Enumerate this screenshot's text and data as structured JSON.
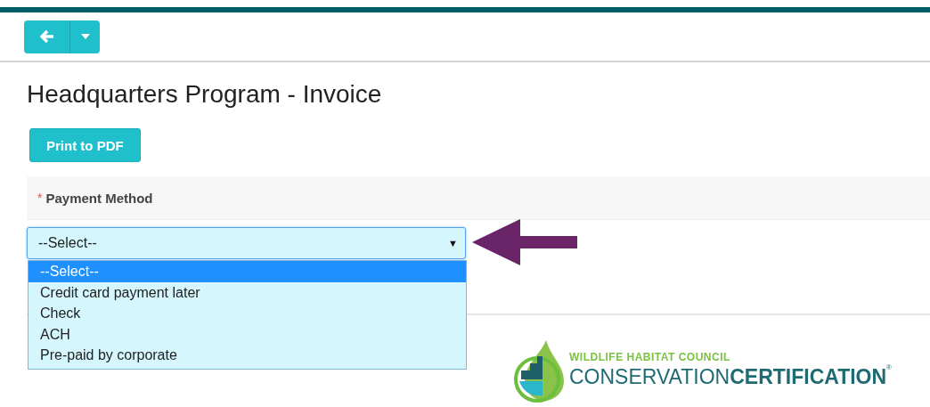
{
  "page": {
    "title": "Headquarters Program - Invoice",
    "print_button": "Print to PDF"
  },
  "payment_field": {
    "required_mark": "*",
    "label": "Payment Method",
    "value": "--Select--",
    "caret": "▼",
    "expanded": true,
    "options": [
      {
        "label": "--Select--",
        "selected": true
      },
      {
        "label": "Credit card payment later",
        "selected": false
      },
      {
        "label": "Check",
        "selected": false
      },
      {
        "label": "ACH",
        "selected": false
      },
      {
        "label": "Pre-paid by corporate",
        "selected": false
      }
    ]
  },
  "logo": {
    "tagline": "WILDLIFE HABITAT COUNCIL",
    "word_light": "CONSERVATION",
    "word_bold": "CERTIFICATION",
    "registered": "®"
  }
}
